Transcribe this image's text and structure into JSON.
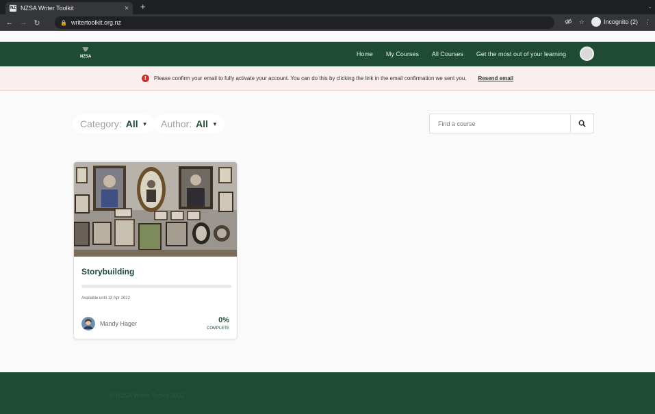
{
  "browser": {
    "tab_title": "NZSA Writer Toolkit",
    "tab_favicon_text": "NZ",
    "close_glyph": "×",
    "newtab_glyph": "+",
    "url": "writertoolkit.org.nz",
    "incognito_label": "Incognito (2)"
  },
  "site": {
    "logo_text": "NZSA",
    "nav": [
      "Home",
      "My Courses",
      "All Courses",
      "Get the most out of your learning"
    ]
  },
  "alert": {
    "message": "Please confirm your email to fully activate your account. You can do this by clicking the link in the email confirmation we sent you.",
    "link": "Resend email"
  },
  "filters": {
    "category_label": "Category:",
    "category_value": "All",
    "author_label": "Author:",
    "author_value": "All",
    "search_placeholder": "Find a course"
  },
  "course": {
    "title": "Storybuilding",
    "availability": "Available until 13 Apr 2022",
    "author": "Mandy Hager",
    "progress_percent": "0%",
    "progress_label": "COMPLETE",
    "progress_fraction": 0
  },
  "footer": {
    "copyright": "© NZSA Writer Toolkit 2022"
  },
  "colors": {
    "brand_green": "#1f4a33",
    "alert_bg": "#fbeeee",
    "alert_icon": "#d0322b"
  }
}
